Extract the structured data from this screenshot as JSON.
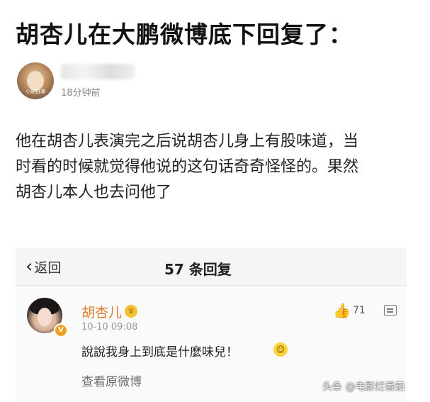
{
  "headline": "胡杏儿在大鹏微博底下回复了：",
  "post": {
    "avatar_label": "小胡自演",
    "time": "18分钟前",
    "body_lines": [
      "他在胡杏儿表演完之后说胡杏儿身上有股味道，当",
      "时看的时候就觉得他说的这句话奇奇怪怪的。果然",
      "胡杏儿本人也去问他了"
    ]
  },
  "reply_screen": {
    "back_label": "返回",
    "back_icon": "chevron-left-icon",
    "title": "57 条回复",
    "comment": {
      "author": "胡杏儿",
      "verified_badge": "V",
      "time": "10-10 09:08",
      "text": "說說我身上到底是什麼味兒！",
      "like_count": "71",
      "view_original": "查看原微博"
    }
  },
  "watermark": "头条 @电影烂番茄",
  "colors": {
    "accent": "#e07a2e",
    "badge": "#f0a020"
  }
}
